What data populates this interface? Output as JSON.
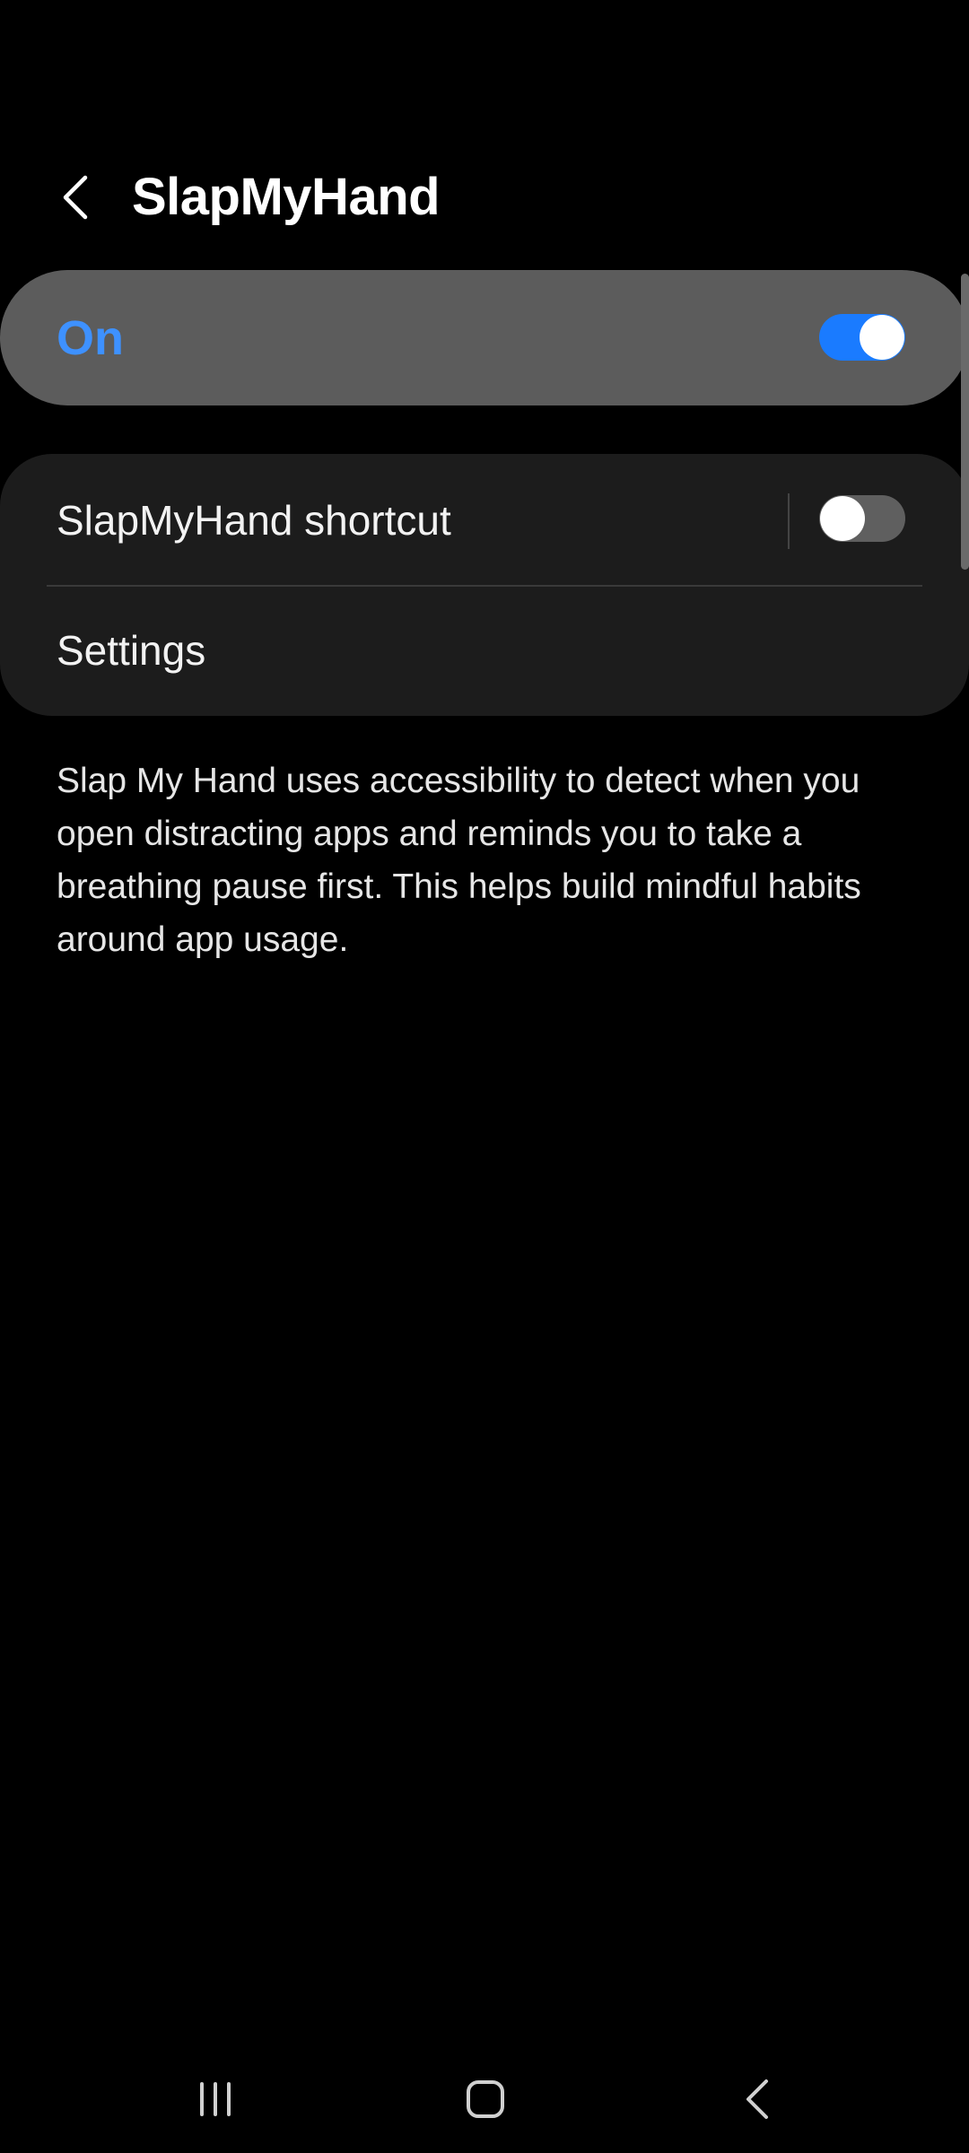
{
  "header": {
    "title": "SlapMyHand",
    "back_icon": "chevron-left-icon"
  },
  "master_switch": {
    "label": "On",
    "state": true,
    "label_color": "#3e91ff",
    "accent_color": "#1a7bff"
  },
  "options": {
    "shortcut_label": "SlapMyHand shortcut",
    "shortcut_state": false,
    "settings_label": "Settings"
  },
  "description": "Slap My Hand uses accessibility to detect when you open distracting apps and reminds you to take a breathing pause first. This helps build mindful habits around app usage.",
  "navbar": {
    "recents_icon": "recents-icon",
    "home_icon": "home-icon",
    "back_icon": "back-icon"
  },
  "colors": {
    "background": "#000000",
    "master_card": "#5c5c5c",
    "options_card": "#1c1c1c",
    "toggle_off_track": "#5f5f5f"
  }
}
